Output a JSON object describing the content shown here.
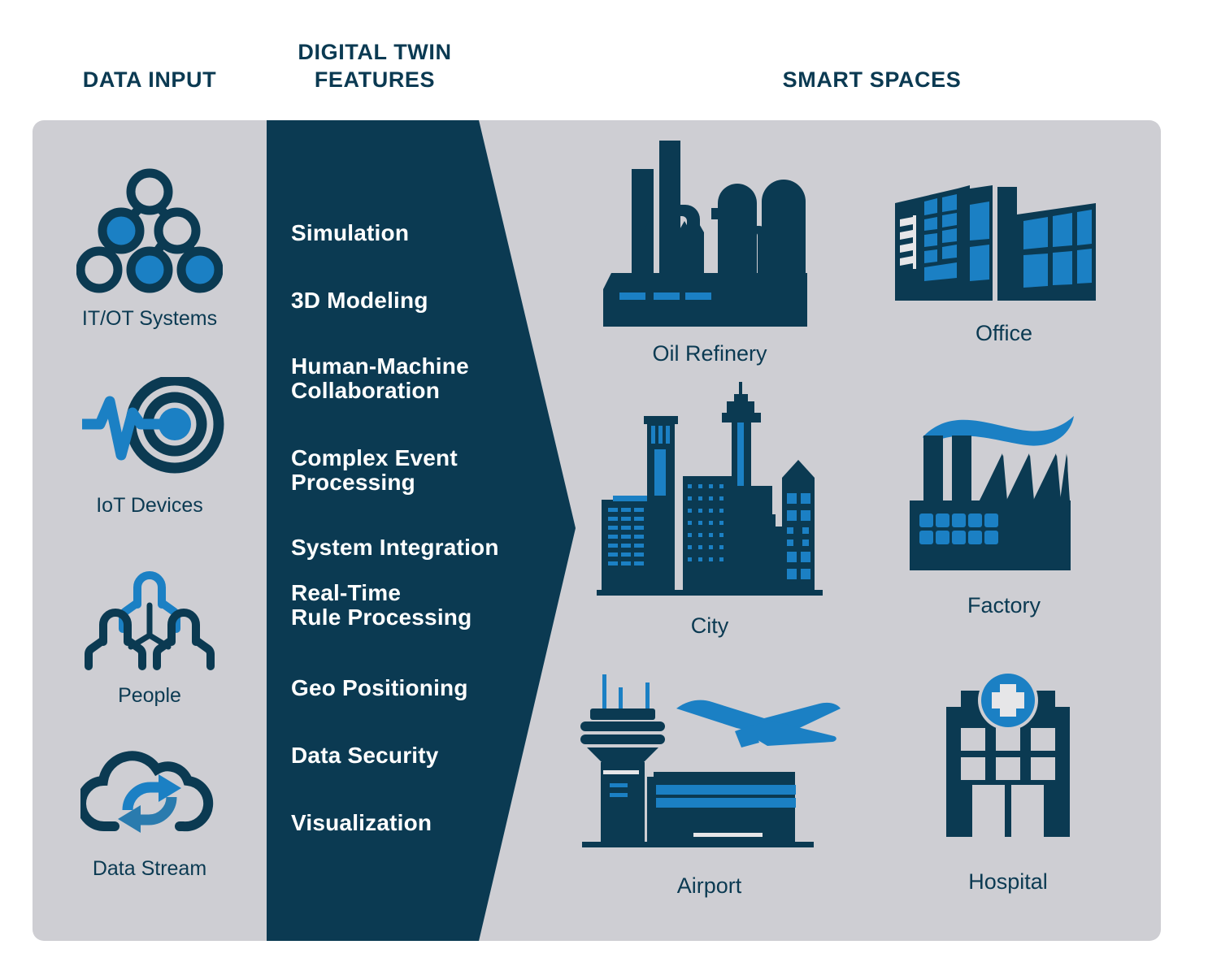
{
  "headers": {
    "data_input": "DATA INPUT",
    "digital_twin_features": "DIGITAL TWIN\nFEATURES",
    "digital_twin_features_line1": "DIGITAL TWIN",
    "digital_twin_features_line2": "FEATURES",
    "smart_spaces": "SMART SPACES"
  },
  "colors": {
    "panel_background": "#CECED3",
    "dark_navy": "#0B3A52",
    "accent_blue": "#1B80C4",
    "white": "#FFFFFF",
    "page_background": "#FFFFFF"
  },
  "data_input": {
    "items": [
      {
        "label": "IT/OT Systems",
        "icon": "network-tree-icon"
      },
      {
        "label": "IoT Devices",
        "icon": "pulse-target-icon"
      },
      {
        "label": "People",
        "icon": "people-group-icon"
      },
      {
        "label": "Data Stream",
        "icon": "cloud-sync-icon"
      }
    ]
  },
  "digital_twin_features": {
    "items": [
      {
        "lines": [
          "Simulation"
        ]
      },
      {
        "lines": [
          "3D Modeling"
        ]
      },
      {
        "lines": [
          "Human-Machine",
          "Collaboration"
        ]
      },
      {
        "lines": [
          "Complex Event",
          "Processing"
        ]
      },
      {
        "lines": [
          "System Integration"
        ]
      },
      {
        "lines": [
          "Real-Time",
          "Rule Processing"
        ]
      },
      {
        "lines": [
          "Geo Positioning"
        ]
      },
      {
        "lines": [
          "Data Security"
        ]
      },
      {
        "lines": [
          "Visualization"
        ]
      }
    ],
    "flat_labels": [
      "Simulation",
      "3D Modeling",
      "Human-Machine Collaboration",
      "Complex Event Processing",
      "System Integration",
      "Real-Time Rule Processing",
      "Geo Positioning",
      "Data Security",
      "Visualization"
    ]
  },
  "smart_spaces": {
    "items": [
      {
        "label": "Oil Refinery",
        "icon": "oil-refinery-icon"
      },
      {
        "label": "Office",
        "icon": "office-building-icon"
      },
      {
        "label": "City",
        "icon": "city-skyline-icon"
      },
      {
        "label": "Factory",
        "icon": "factory-icon"
      },
      {
        "label": "Airport",
        "icon": "airport-icon"
      },
      {
        "label": "Hospital",
        "icon": "hospital-icon"
      }
    ]
  }
}
